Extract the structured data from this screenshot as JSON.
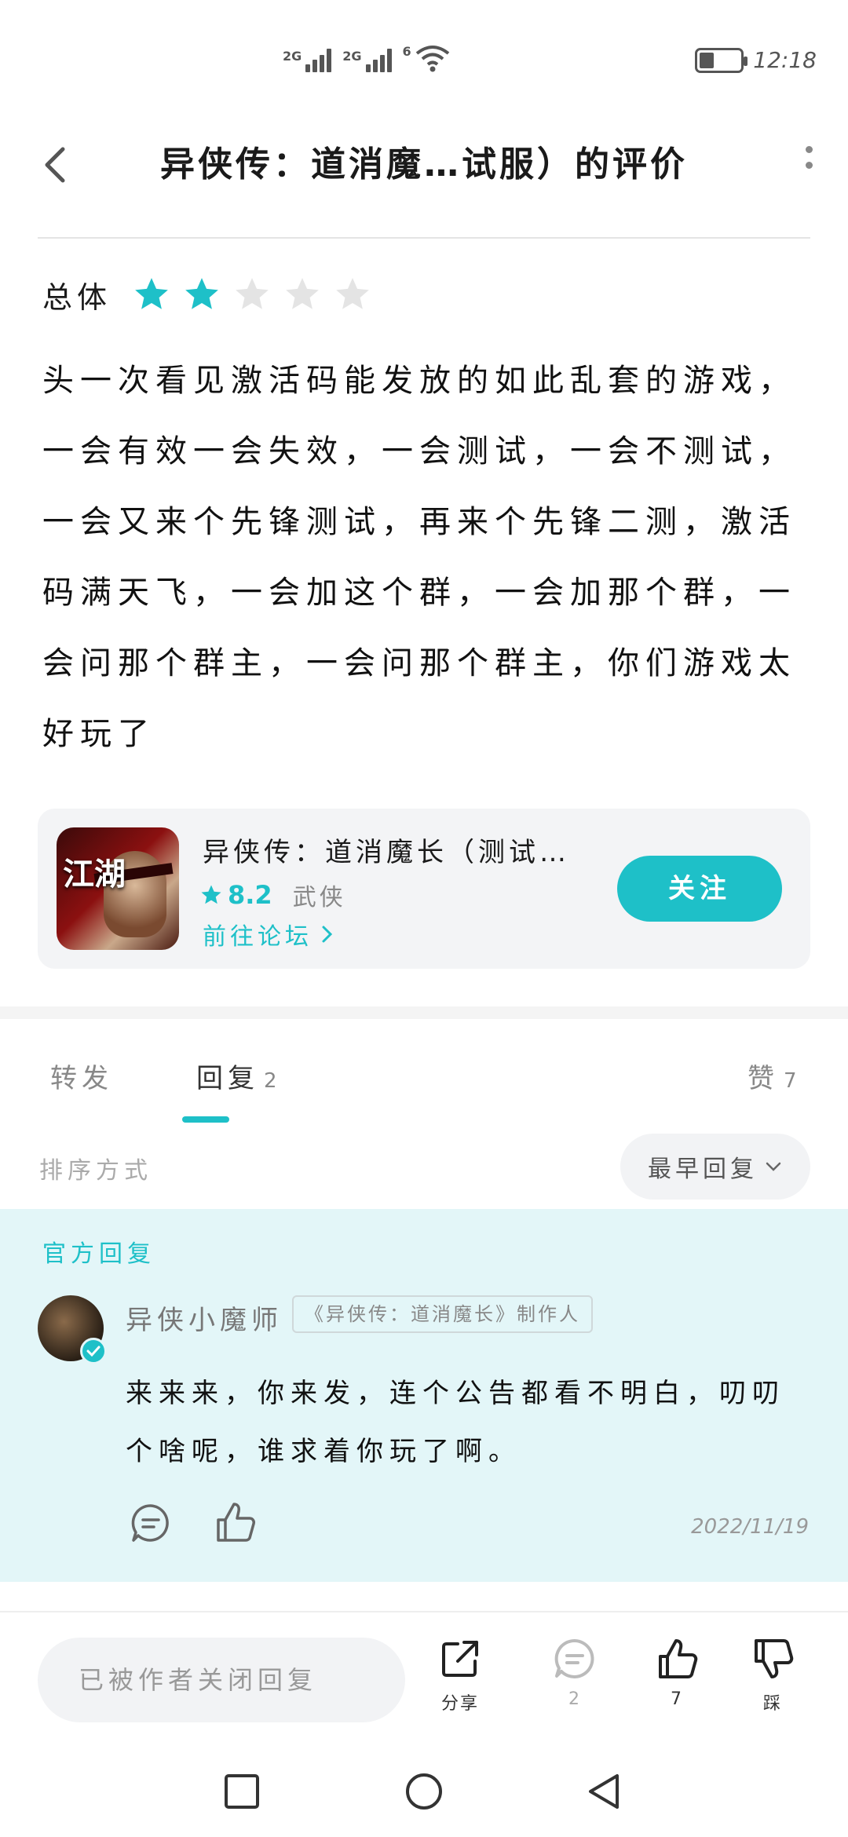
{
  "status_bar": {
    "signal1_gen": "2G",
    "signal2_gen": "2G",
    "wifi_gen": "6",
    "time": "12:18"
  },
  "header": {
    "title": "异侠传：道消魔…试服）的评价",
    "back_icon": "chevron-left-icon",
    "more_icon": "more-vertical-icon"
  },
  "rating": {
    "label": "总体",
    "stars_filled": 2,
    "stars_total": 5,
    "star_color": "#1ec0c8",
    "star_empty_color": "#e4e4e4"
  },
  "review": {
    "text": "头一次看见激活码能发放的如此乱套的游戏，一会有效一会失效，一会测试，一会不测试，一会又来个先锋测试，再来个先锋二测，激活码满天飞，一会加这个群，一会加那个群，一会问那个群主，一会问那个群主，你们游戏太好玩了"
  },
  "game_card": {
    "name": "异侠传：道消魔长（测试…",
    "icon_text": "江湖",
    "score": "8.2",
    "genre": "武侠",
    "forum_link": "前往论坛",
    "follow_label": "关注"
  },
  "tabs": [
    {
      "label": "转发",
      "count": ""
    },
    {
      "label": "回复",
      "count": "2"
    },
    {
      "label": "赞",
      "count": "7"
    }
  ],
  "sort": {
    "label": "排序方式",
    "selected": "最早回复"
  },
  "official_reply": {
    "section_label": "官方回复",
    "author": "异侠小魔师",
    "author_tag": "《异侠传：道消魔长》制作人",
    "text": "来来来，你来发，连个公告都看不明白，叨叨个啥呢，谁求着你玩了啊。",
    "date": "2022/11/19"
  },
  "action_bar": {
    "input_placeholder": "已被作者关闭回复",
    "share_label": "分享",
    "comment_count": "2",
    "like_count": "7",
    "dislike_label": "踩"
  },
  "colors": {
    "accent": "#1ec0c8",
    "official_bg": "#e3f6f8"
  }
}
